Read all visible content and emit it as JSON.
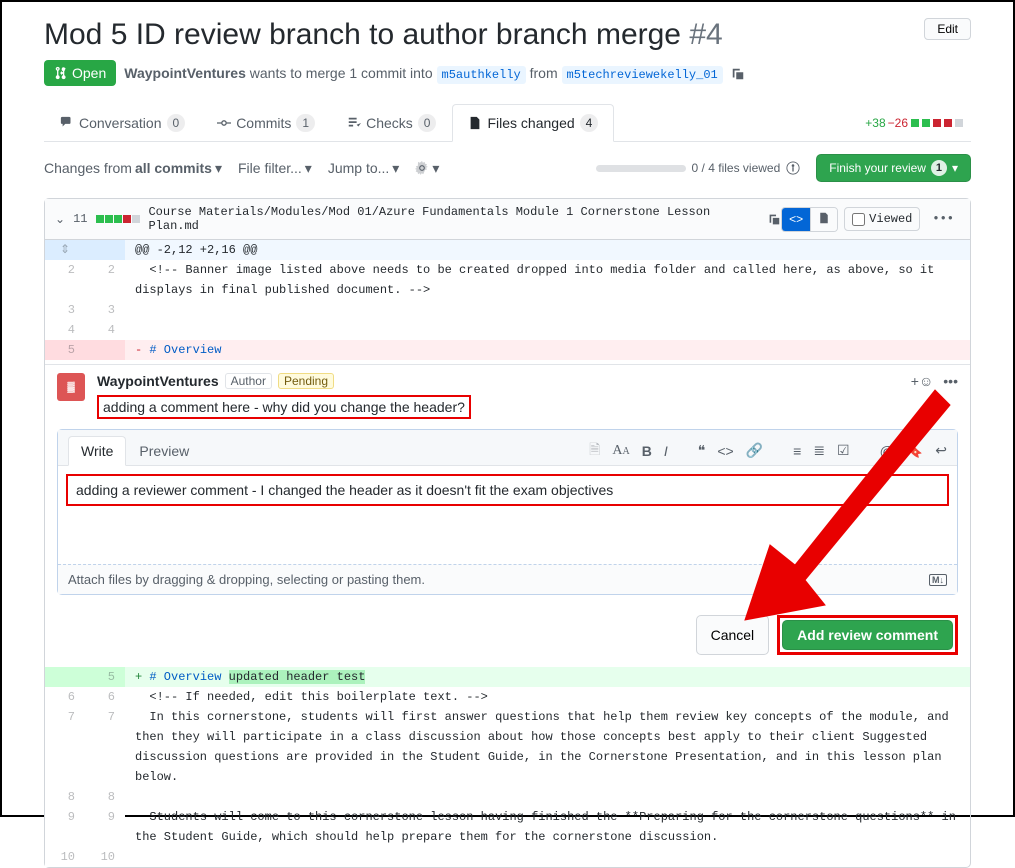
{
  "pr": {
    "title": "Mod 5 ID review branch to author branch merge",
    "number": "#4",
    "state": "Open",
    "edit": "Edit"
  },
  "merge": {
    "author": "WaypointVentures",
    "text1": " wants to merge 1 commit into ",
    "base": "m5authkelly",
    "from": " from ",
    "head": "m5techreviewekelly_01"
  },
  "tabs": {
    "conversation": {
      "label": "Conversation",
      "count": "0"
    },
    "commits": {
      "label": "Commits",
      "count": "1"
    },
    "checks": {
      "label": "Checks",
      "count": "0"
    },
    "files": {
      "label": "Files changed",
      "count": "4"
    }
  },
  "diffstat": {
    "add": "+38",
    "del": "−26"
  },
  "toolbar": {
    "changes_from": "Changes from",
    "all_commits": "all commits",
    "file_filter": "File filter...",
    "jump_to": "Jump to...",
    "viewed": "0 / 4 files viewed",
    "finish": "Finish your review",
    "finish_count": "1"
  },
  "file": {
    "lines": "11",
    "path": "Course Materials/Modules/Mod 01/Azure Fundamentals Module 1 Cornerstone Lesson Plan.md",
    "viewed": "Viewed"
  },
  "diff": {
    "hunk": "@@ -2,12 +2,16 @@",
    "line2": "  <!-- Banner image listed above needs to be created dropped into media folder and called here, as above, so it displays in final published document. -->",
    "del5": "# Overview",
    "add5_a": "# Overview ",
    "add5_b": "updated header test",
    "line6": "  <!-- If needed, edit this boilerplate text. -->",
    "line7": "  In this cornerstone, students will first answer questions that help them review key concepts of the module, and then they will participate in a class discussion about how those concepts best apply to their client Suggested discussion questions are provided in the Student Guide, in the Cornerstone Presentation, and in this lesson plan below.",
    "line9": "  Students will come to this cornerstone lesson having finished the **Preparing for the cornerstone questions** in the Student Guide, which should help prepare them for the cornerstone discussion."
  },
  "comment": {
    "author": "WaypointVentures",
    "role": "Author",
    "pending": "Pending",
    "existing": "adding a comment here - why did you change the header?"
  },
  "form": {
    "write": "Write",
    "preview": "Preview",
    "input": "adding a reviewer comment - I changed the header as it doesn't fit the exam objectives",
    "attach": "Attach files by dragging & dropping, selecting or pasting them.",
    "cancel": "Cancel",
    "add": "Add review comment"
  }
}
